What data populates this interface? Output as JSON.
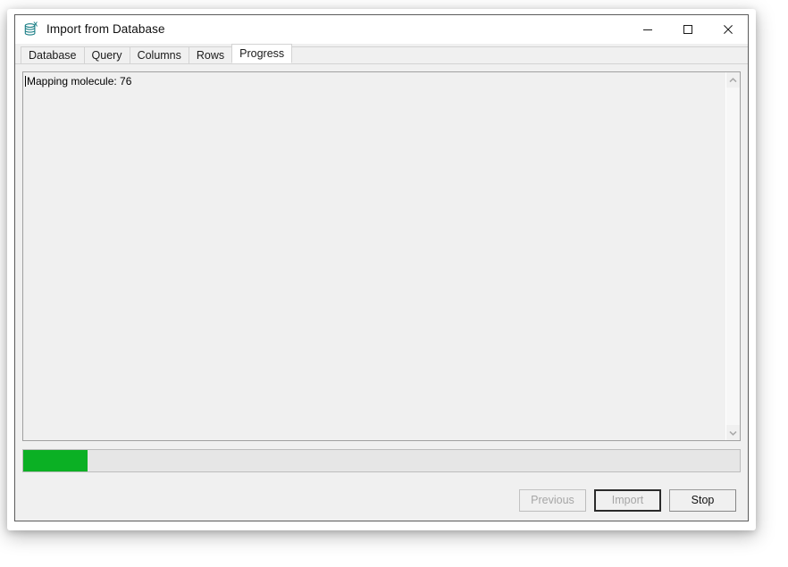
{
  "window": {
    "title": "Import from Database",
    "icon": "database-import-icon",
    "controls": {
      "minimize": "minimize-icon",
      "maximize": "maximize-icon",
      "close": "close-icon"
    }
  },
  "tabs": [
    {
      "label": "Database",
      "selected": false
    },
    {
      "label": "Query",
      "selected": false
    },
    {
      "label": "Columns",
      "selected": false
    },
    {
      "label": "Rows",
      "selected": false
    },
    {
      "label": "Progress",
      "selected": true
    }
  ],
  "log": {
    "text": "Mapping molecule: 76",
    "caret": true
  },
  "scrollbar": {
    "up_icon": "chevron-up-icon",
    "down_icon": "chevron-down-icon"
  },
  "progress": {
    "percent": 9,
    "fill_color": "#0bb024",
    "track_color": "#e6e6e6"
  },
  "buttons": [
    {
      "label": "Previous",
      "enabled": false,
      "default": false
    },
    {
      "label": "Import",
      "enabled": false,
      "default": true
    },
    {
      "label": "Stop",
      "enabled": true,
      "default": false
    }
  ]
}
